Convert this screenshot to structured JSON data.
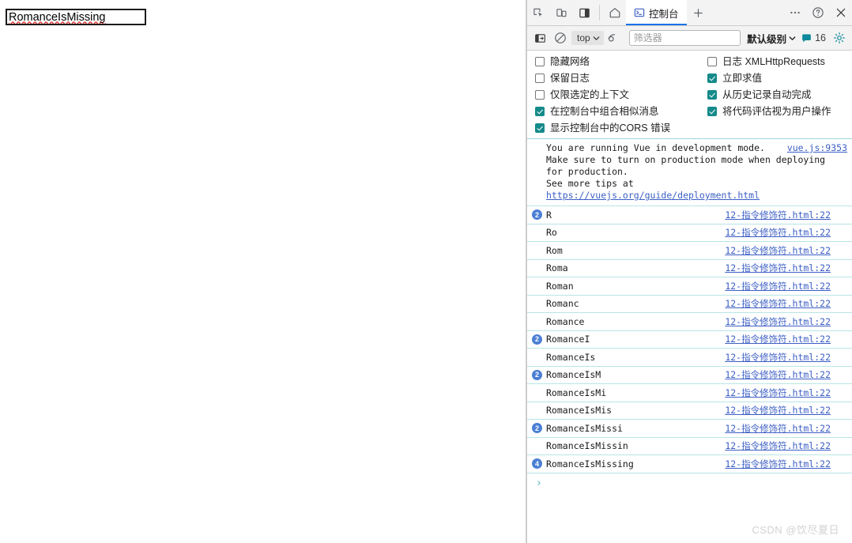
{
  "page": {
    "input_value": "RomanceIsMissing",
    "input_placeholder": ""
  },
  "devtools": {
    "tabstrip": {
      "inspect_icon": "inspect-element-icon",
      "device_icon": "device-toolbar-icon",
      "dock_icon": "dock-panel-icon",
      "home_icon": "home-icon",
      "tabs": [
        {
          "label": "控制台",
          "icon": "console-terminal-icon",
          "active": true
        }
      ],
      "add_label": "+",
      "more_label": "⋯",
      "help_label": "?",
      "close_label": "×"
    },
    "toolbar": {
      "sidebar_icon": "console-sidebar-icon",
      "clear_icon": "clear-console-icon",
      "context_value": "top",
      "eye_icon": "live-expression-icon",
      "filter_placeholder": "筛选器",
      "filter_value": "",
      "level_label": "默认级别",
      "message_count": "16",
      "settings_icon": "settings-gear-icon"
    },
    "settings": {
      "column_left": [
        {
          "label": "隐藏网络",
          "checked": false
        },
        {
          "label": "保留日志",
          "checked": false
        },
        {
          "label": "仅限选定的上下文",
          "checked": false
        },
        {
          "label": "在控制台中组合相似消息",
          "checked": true
        },
        {
          "label": "显示控制台中的CORS 错误",
          "checked": true
        }
      ],
      "column_right": [
        {
          "label": "日志 XMLHttpRequests",
          "checked": false
        },
        {
          "label": "立即求值",
          "checked": true
        },
        {
          "label": "从历史记录自动完成",
          "checked": true
        },
        {
          "label": "将代码评估视为用户操作",
          "checked": true
        }
      ]
    },
    "console": {
      "vue_message": {
        "line1": "You are running Vue in development mode.",
        "line2": "Make sure to turn on production mode when deploying",
        "line3": "for production.",
        "line4_prefix": "See more tips at ",
        "line4_link": "https://vuejs.org/guide/deployment.html",
        "source": "vue.js:9353"
      },
      "source_link": "12-指令修饰符.html:22",
      "rows": [
        {
          "badge": "2",
          "text": "R"
        },
        {
          "badge": "",
          "text": "Ro"
        },
        {
          "badge": "",
          "text": "Rom"
        },
        {
          "badge": "",
          "text": "Roma"
        },
        {
          "badge": "",
          "text": "Roman"
        },
        {
          "badge": "",
          "text": "Romanc"
        },
        {
          "badge": "",
          "text": "Romance"
        },
        {
          "badge": "2",
          "text": "RomanceI"
        },
        {
          "badge": "",
          "text": "RomanceIs"
        },
        {
          "badge": "2",
          "text": "RomanceIsM"
        },
        {
          "badge": "",
          "text": "RomanceIsMi"
        },
        {
          "badge": "",
          "text": "RomanceIsMis"
        },
        {
          "badge": "2",
          "text": "RomanceIsMissi"
        },
        {
          "badge": "",
          "text": "RomanceIsMissin"
        },
        {
          "badge": "4",
          "text": "RomanceIsMissing"
        }
      ],
      "prompt_glyph": "›"
    }
  },
  "watermark": "CSDN @饮尽夏日",
  "colors": {
    "tab_accent": "#1a73e8",
    "checkbox_checked": "#158a8a",
    "badge": "#4b7fd4",
    "link": "#3c5fc4",
    "row_separator": "#b9e5e5",
    "prompt": "#56b3bf",
    "spellcheck_underline": "#e53935"
  }
}
